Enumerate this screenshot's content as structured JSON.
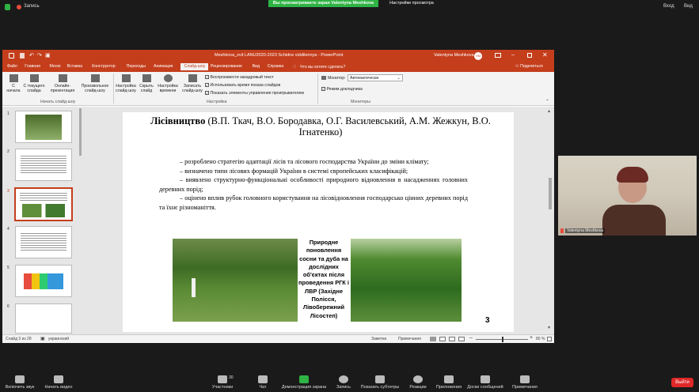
{
  "zoom": {
    "record_label": "Запись",
    "banner_text": "Вы просматриваете экран Valentyna Meshkova",
    "view_settings": "Настройки просмотра",
    "enter_label": "Вход",
    "fullscreen_label": "Вид",
    "participant_name": "Valentyna Meshkova",
    "toolbar": {
      "mute": "Включить звук",
      "video": "Начать видео",
      "participants": "Участники",
      "participants_count": "30",
      "chat": "Чат",
      "share": "Демонстрация экрана",
      "record": "Запись",
      "captions": "Показать субтитры",
      "reactions": "Реакции",
      "apps": "Приложения",
      "whiteboard": "Доски сообщений",
      "notes": "Примечания",
      "leave": "Выйти"
    }
  },
  "ppt": {
    "doc_title": "Meshkova_zvit LANU2020-2023 Schidne viddilennya  -  PowerPoint",
    "user": "Valentyna Meshkova",
    "user_initials": "VM",
    "tabs": [
      "Файл",
      "Главная",
      "Меню",
      "Вставка",
      "Конструктор",
      "Переходы",
      "Анимация",
      "Слайд-шоу",
      "Рецензирование",
      "Вид",
      "Справка"
    ],
    "active_tab": "Слайд-шоу",
    "search_hint": "Что вы хотите сделать?",
    "share": "Поделиться",
    "ribbon": {
      "start_from_beginning": "С начала",
      "from_current": "С текущего слайда",
      "online_presentation": "Онлайн-презентация",
      "custom_show": "Произвольное слайд-шоу",
      "group_start": "Начать слайд-шоу",
      "setup": "Настройка слайд-шоу",
      "hide_slide": "Скрыть слайд",
      "rehearse": "Настройка времени",
      "record_show": "Записать слайд-шоу",
      "opt_narration": "Воспроизвести закадровый текст",
      "opt_timings": "Использовать время показа слайдов",
      "opt_controls": "Показать элементы управления проигрывателем",
      "group_setup": "Настройка",
      "monitor_label": "Монитор:",
      "monitor_value": "Автоматически",
      "presenter_view": "Режим докладчика",
      "group_monitors": "Мониторы"
    },
    "status": {
      "slide_info": "Слайд 3 из 28",
      "language": "украинский",
      "notes": "Заметки",
      "comments": "Примечания",
      "zoom_pct": "80 %"
    }
  },
  "slide": {
    "title_bold": "Лісівництво",
    "title_rest": " (В.П. Ткач, В.О. Бородавка, О.Г. Василевський, А.М. Жежкун, В.О. Ігнатенко)",
    "bullets": [
      "– розроблено стратегію адаптації лісів та лісового господарства України до зміни клімату;",
      "– визначено типи лісових формацій України в системі європейських класифікацій;",
      "– виявлено структурно-функціональні особливості природного відновлення в насадженнях головних деревних порід;",
      "– оцінено вплив рубок головного користування на лісовідновлення господарсько цінних деревних порід та їхнє різноманіття."
    ],
    "caption": "Природне поновлення сосни та дуба на дослідних об'єктах після проведення РГК і ЛВР (Західне Полісся, Лівобережний Лісостеп)",
    "page_number": "3"
  },
  "thumbnails": [
    "1",
    "2",
    "3",
    "4",
    "5",
    "6"
  ],
  "active_thumbnail": "3"
}
